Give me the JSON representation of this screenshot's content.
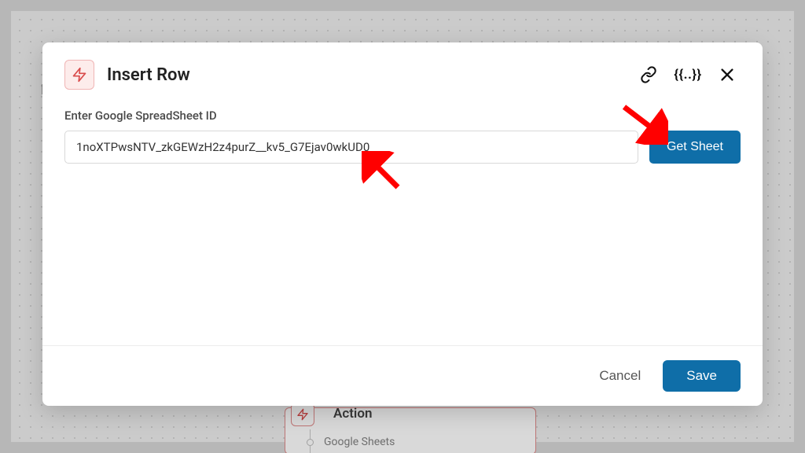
{
  "modal": {
    "title": "Insert Row",
    "field_label": "Enter Google SpreadSheet ID",
    "field_value": "1noXTPwsNTV_zkGEWzH2z4purZ__kv5_G7Ejav0wkUD0",
    "get_sheet_label": "Get Sheet",
    "variables_label": "{{..}}",
    "cancel_label": "Cancel",
    "save_label": "Save"
  },
  "background": {
    "edge_letter": "E",
    "node_title": "Action",
    "node_sub": "Google Sheets"
  },
  "colors": {
    "accent": "#0f6ea8",
    "danger": "#d94c4c",
    "arrow": "#ff0000"
  }
}
